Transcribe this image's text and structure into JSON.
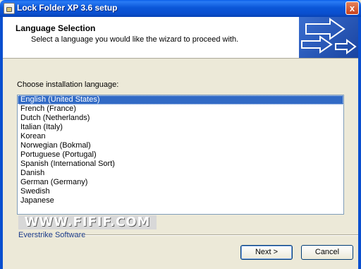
{
  "window": {
    "title": "Lock Folder XP 3.6 setup",
    "close_glyph": "x"
  },
  "header": {
    "title": "Language Selection",
    "subtitle": "Select a language you would like the wizard to proceed with."
  },
  "main": {
    "prompt": "Choose installation language:",
    "languages": [
      "English (United States)",
      "French (France)",
      "Dutch (Netherlands)",
      "Italian (Italy)",
      "Korean",
      "Norwegian (Bokmal)",
      "Portuguese (Portugal)",
      "Spanish (International Sort)",
      "Danish",
      "German (Germany)",
      "Swedish",
      "Japanese"
    ],
    "selected_language": "English (United States)"
  },
  "watermark": "WWW.FIFIF.COM",
  "footer": {
    "brand": "Everstrike Software"
  },
  "buttons": {
    "next": "Next >",
    "cancel": "Cancel"
  }
}
